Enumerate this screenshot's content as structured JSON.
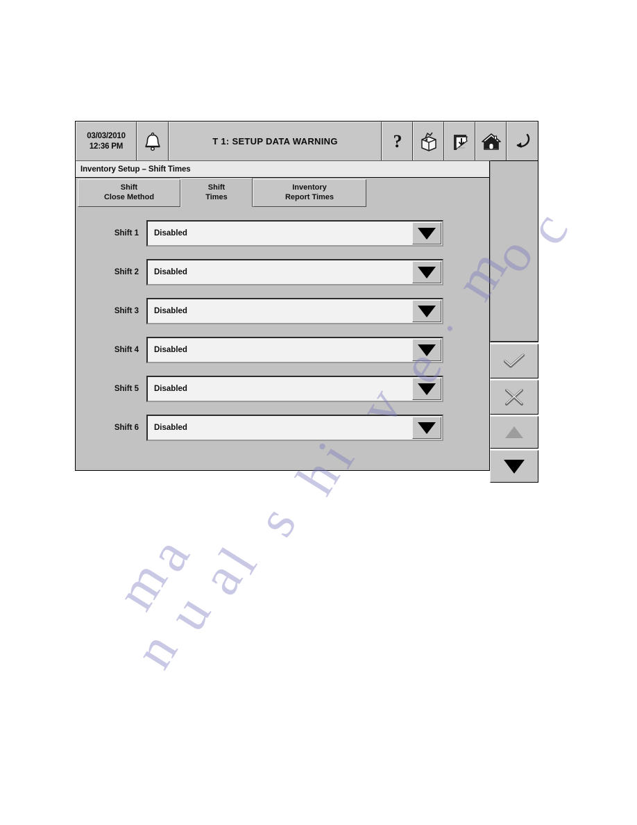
{
  "topbar": {
    "date": "03/03/2010",
    "time": "12:36 PM",
    "alarm_icon": "bell-icon",
    "title": "T 1: SETUP DATA WARNING",
    "buttons": [
      {
        "name": "help-button",
        "icon": "question-mark-icon"
      },
      {
        "name": "inventory-button",
        "icon": "open-box-icon"
      },
      {
        "name": "print-report-button",
        "icon": "receipt-printout-icon"
      },
      {
        "name": "home-button",
        "icon": "home-icon"
      },
      {
        "name": "back-button",
        "icon": "return-arrow-icon"
      }
    ]
  },
  "breadcrumb": "Inventory Setup – Shift Times",
  "tabs": [
    {
      "line1": "Shift",
      "line2": "Close Method",
      "active": false
    },
    {
      "line1": "Shift",
      "line2": "Times",
      "active": true
    },
    {
      "line1": "Inventory",
      "line2": "Report Times",
      "active": false
    }
  ],
  "shift_rows": [
    {
      "label": "Shift 1",
      "value": "Disabled"
    },
    {
      "label": "Shift 2",
      "value": "Disabled"
    },
    {
      "label": "Shift 3",
      "value": "Disabled"
    },
    {
      "label": "Shift 4",
      "value": "Disabled"
    },
    {
      "label": "Shift 5",
      "value": "Disabled"
    },
    {
      "label": "Shift 6",
      "value": "Disabled"
    }
  ],
  "side_rail": [
    {
      "name": "accept-button",
      "icon": "checkmark-icon",
      "enabled": true
    },
    {
      "name": "cancel-button",
      "icon": "x-mark-icon",
      "enabled": true
    },
    {
      "name": "scroll-up-button",
      "icon": "triangle-up-icon",
      "enabled": false
    },
    {
      "name": "scroll-down-button",
      "icon": "triangle-down-icon",
      "enabled": true
    }
  ],
  "colors": {
    "panel_gray": "#c2c2c2",
    "button_gray": "#c6c6c6",
    "field_white": "#f2f2f2",
    "breadcrumb_bg": "#e9e9e9",
    "text": "#0f0f0f",
    "disabled_arrow": "#9d9d9d"
  },
  "watermark": {
    "line1": "manualshive.com"
  }
}
